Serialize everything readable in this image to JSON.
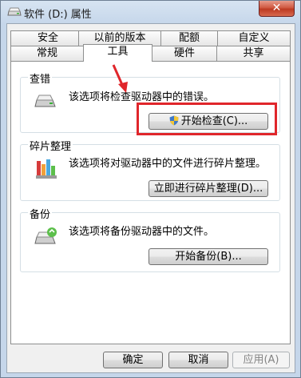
{
  "window": {
    "title": "软件 (D:) 属性",
    "close_label": "✕"
  },
  "tabs": {
    "row1": [
      "安全",
      "以前的版本",
      "配额",
      "自定义"
    ],
    "row2": [
      "常规",
      "工具",
      "硬件",
      "共享"
    ],
    "active": "工具"
  },
  "groups": {
    "check": {
      "title": "查错",
      "description": "该选项将检查驱动器中的错误。",
      "button_label": "开始检查(C)..."
    },
    "defrag": {
      "title": "碎片整理",
      "description": "该选项将对驱动器中的文件进行碎片整理。",
      "button_label": "立即进行碎片整理(D)..."
    },
    "backup": {
      "title": "备份",
      "description": "该选项将备份驱动器中的文件。",
      "button_label": "开始备份(B)..."
    }
  },
  "footer": {
    "ok_label": "确定",
    "cancel_label": "取消",
    "apply_label": "应用(A)"
  },
  "colors": {
    "annotation": "#e0262b",
    "close_button": "#c8472e"
  },
  "icons": [
    "drive-icon",
    "close-icon",
    "disk-check-icon",
    "defrag-icon",
    "backup-icon",
    "uac-shield-icon",
    "arrow-annotation"
  ]
}
